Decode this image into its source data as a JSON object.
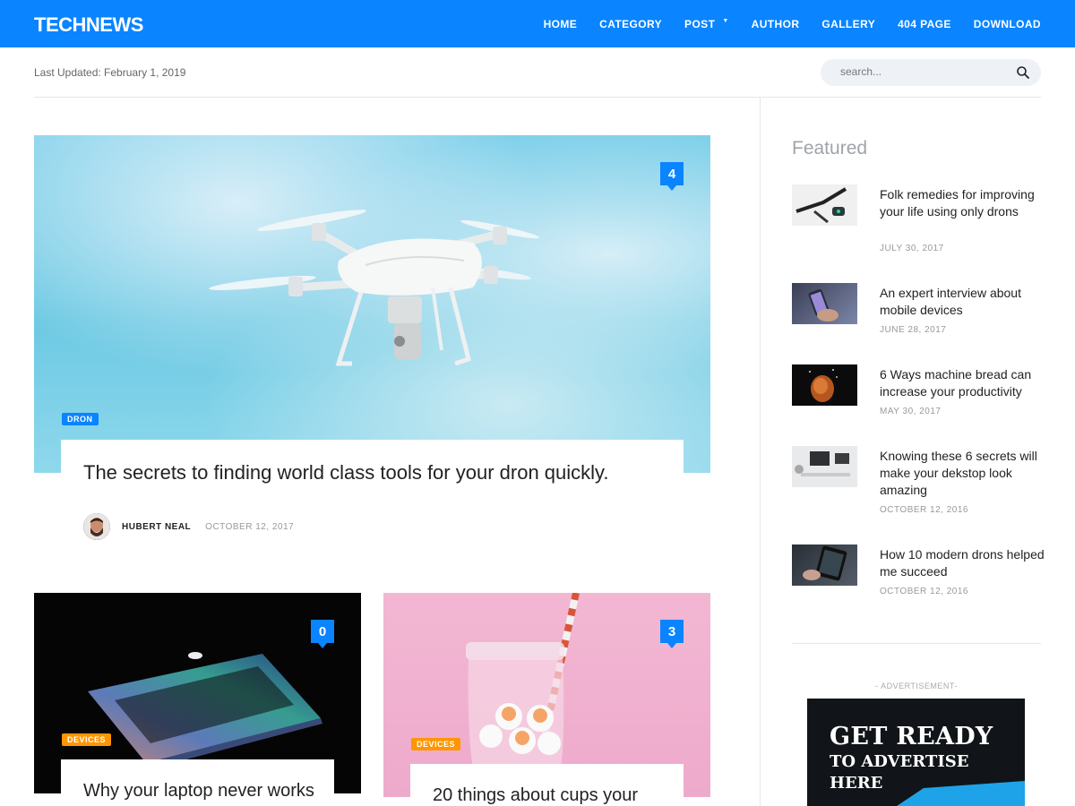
{
  "header": {
    "logo": "TECHNEWS",
    "nav": [
      {
        "label": "HOME"
      },
      {
        "label": "CATEGORY"
      },
      {
        "label": "POST"
      },
      {
        "label": "AUTHOR"
      },
      {
        "label": "GALLERY"
      },
      {
        "label": "404 PAGE"
      },
      {
        "label": "DOWNLOAD"
      }
    ]
  },
  "subbar": {
    "last_updated": "Last Updated: February 1, 2019",
    "search_placeholder": "search..."
  },
  "hero": {
    "comments": "4",
    "category": "DRON",
    "title": "The secrets to finding world class tools for your dron quickly.",
    "author": "HUBERT NEAL",
    "date": "OCTOBER 12, 2017"
  },
  "cards": [
    {
      "comments": "0",
      "category": "DEVICES",
      "title": "Why your laptop never works"
    },
    {
      "comments": "3",
      "category": "DEVICES",
      "title": "20 things about cups your"
    }
  ],
  "sidebar": {
    "heading": "Featured",
    "items": [
      {
        "title": "Folk remedies for improving your life using only drons",
        "date": "JULY 30, 2017"
      },
      {
        "title": "An expert interview about mobile devices",
        "date": "JUNE 28, 2017"
      },
      {
        "title": "6 Ways machine bread can increase your productivity",
        "date": "MAY 30, 2017"
      },
      {
        "title": "Knowing these 6 secrets will make your dekstop look amazing",
        "date": "OCTOBER 12, 2016"
      },
      {
        "title": "How 10 modern drons helped me succeed",
        "date": "OCTOBER 12, 2016"
      }
    ],
    "ad_label": "- ADVERTISEMENT-",
    "ad_lines": [
      "GET READY",
      "TO ADVERTISE",
      "HERE"
    ]
  },
  "colors": {
    "brand": "#0a84ff",
    "tag_dron": "#0a84ff",
    "tag_devices": "#ff9500"
  }
}
